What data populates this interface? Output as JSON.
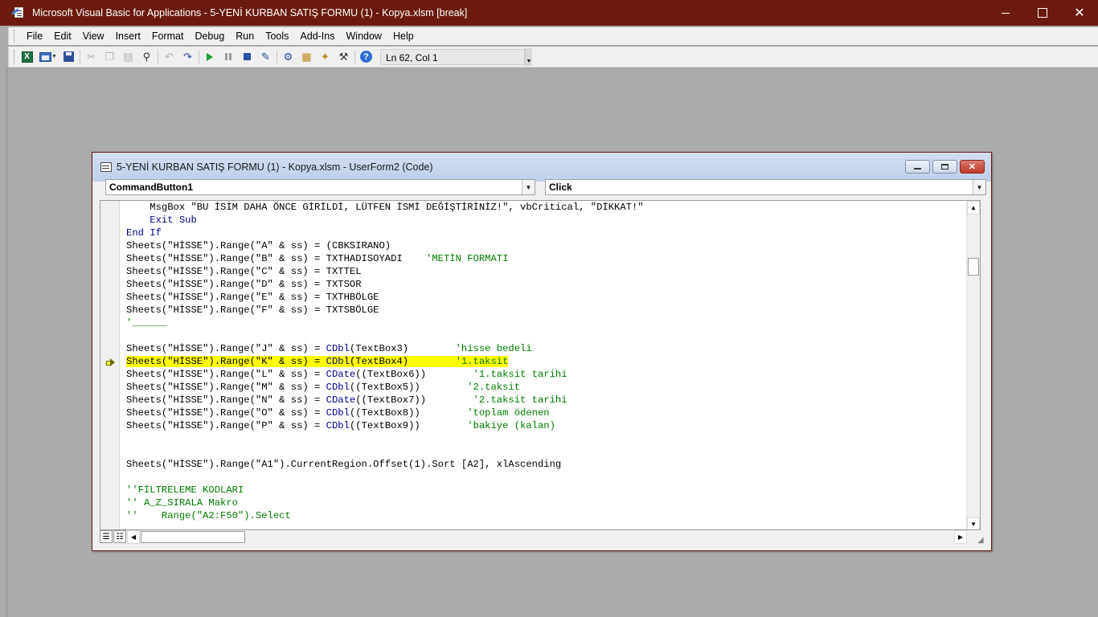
{
  "app": {
    "title": "Microsoft Visual Basic for Applications - 5-YENİ KURBAN SATIŞ FORMU  (1) - Kopya.xlsm [break]",
    "close_glyph": "✕"
  },
  "menu": [
    "File",
    "Edit",
    "View",
    "Insert",
    "Format",
    "Debug",
    "Run",
    "Tools",
    "Add-Ins",
    "Window",
    "Help"
  ],
  "toolbar": {
    "status": "Ln 62, Col 1",
    "excel_glyph": "X",
    "help_glyph": "?"
  },
  "code_window": {
    "title": "5-YENİ KURBAN SATIŞ FORMU  (1) - Kopya.xlsm - UserForm2 (Code)",
    "object_dropdown": "CommandButton1",
    "procedure_dropdown": "Click",
    "close_glyph": "✕"
  },
  "code_lines": [
    [
      {
        "t": "    MsgBox \"BU İSİM DAHA ÖNCE GİRİLDİ, LÜTFEN İSMİ DEĞİŞTİRİNİZ!\", vbCritical, \"DİKKAT!\"",
        "c": ""
      }
    ],
    [
      {
        "t": "    ",
        "c": ""
      },
      {
        "t": "Exit Sub",
        "c": "kw"
      }
    ],
    [
      {
        "t": "End If",
        "c": "kw"
      }
    ],
    [
      {
        "t": "Sheets(\"HİSSE\").Range(\"A\" & ss) = (CBKSIRANO)",
        "c": ""
      }
    ],
    [
      {
        "t": "Sheets(\"HİSSE\").Range(\"B\" & ss) = TXTHADISOYADI    ",
        "c": ""
      },
      {
        "t": "'METİN FORMATI",
        "c": "cm"
      }
    ],
    [
      {
        "t": "Sheets(\"HİSSE\").Range(\"C\" & ss) = TXTTEL",
        "c": ""
      }
    ],
    [
      {
        "t": "Sheets(\"HİSSE\").Range(\"D\" & ss) = TXTSOR",
        "c": ""
      }
    ],
    [
      {
        "t": "Sheets(\"HİSSE\").Range(\"E\" & ss) = TXTHBÖLGE",
        "c": ""
      }
    ],
    [
      {
        "t": "Sheets(\"HİSSE\").Range(\"F\" & ss) = TXTSBÖLGE",
        "c": ""
      }
    ],
    [
      {
        "t": "'______",
        "c": "cm"
      }
    ],
    [
      {
        "t": "",
        "c": ""
      }
    ],
    [
      {
        "t": "Sheets(\"HİSSE\").Range(\"J\" & ss) = ",
        "c": ""
      },
      {
        "t": "CDbl",
        "c": "kw"
      },
      {
        "t": "(TextBox3)        ",
        "c": ""
      },
      {
        "t": "'hisse bedeli",
        "c": "cm"
      }
    ],
    [
      {
        "t": "Sheets(\"HİSSE\").Range(\"K\" & ss) = ",
        "c": "hl"
      },
      {
        "t": "CDbl",
        "c": "hl kw"
      },
      {
        "t": "(TextBox4)        ",
        "c": "hl"
      },
      {
        "t": "'1.taksit",
        "c": "hl cm"
      }
    ],
    [
      {
        "t": "Sheets(\"HİSSE\").Range(\"L\" & ss) = ",
        "c": ""
      },
      {
        "t": "CDate",
        "c": "kw"
      },
      {
        "t": "((TextBox6))        ",
        "c": ""
      },
      {
        "t": "'1.taksit tarihi",
        "c": "cm"
      }
    ],
    [
      {
        "t": "Sheets(\"HİSSE\").Range(\"M\" & ss) = ",
        "c": ""
      },
      {
        "t": "CDbl",
        "c": "kw"
      },
      {
        "t": "((TextBox5))        ",
        "c": ""
      },
      {
        "t": "'2.taksit",
        "c": "cm"
      }
    ],
    [
      {
        "t": "Sheets(\"HİSSE\").Range(\"N\" & ss) = ",
        "c": ""
      },
      {
        "t": "CDate",
        "c": "kw"
      },
      {
        "t": "((TextBox7))        ",
        "c": ""
      },
      {
        "t": "'2.taksit tarihi",
        "c": "cm"
      }
    ],
    [
      {
        "t": "Sheets(\"HİSSE\").Range(\"O\" & ss) = ",
        "c": ""
      },
      {
        "t": "CDbl",
        "c": "kw"
      },
      {
        "t": "((TextBox8))        ",
        "c": ""
      },
      {
        "t": "'toplam ödenen",
        "c": "cm"
      }
    ],
    [
      {
        "t": "Sheets(\"HİSSE\").Range(\"P\" & ss) = ",
        "c": ""
      },
      {
        "t": "CDbl",
        "c": "kw"
      },
      {
        "t": "((TextBox9))        ",
        "c": ""
      },
      {
        "t": "'bakiye (kalan)",
        "c": "cm"
      }
    ],
    [
      {
        "t": "",
        "c": ""
      }
    ],
    [
      {
        "t": "",
        "c": ""
      }
    ],
    [
      {
        "t": "Sheets(\"HİSSE\").Range(\"A1\").CurrentRegion.Offset(1).Sort [A2], xlAscending",
        "c": ""
      }
    ],
    [
      {
        "t": "",
        "c": ""
      }
    ],
    [
      {
        "t": "''FİLTRELEME KODLARI",
        "c": "cm"
      }
    ],
    [
      {
        "t": "'' A_Z_SIRALA Makro",
        "c": "cm"
      }
    ],
    [
      {
        "t": "''    Range(\"A2:F50\").Select",
        "c": "cm"
      }
    ]
  ]
}
